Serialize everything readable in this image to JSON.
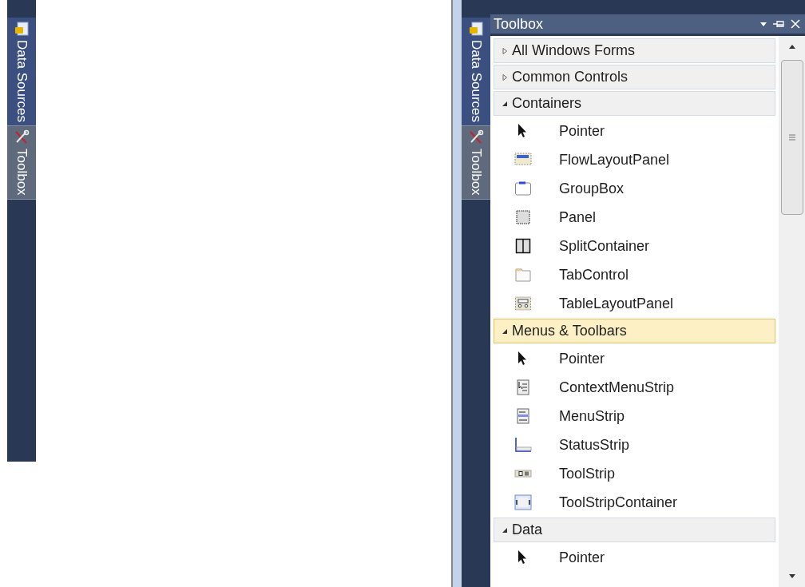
{
  "collapsed_dock": {
    "tabs": [
      {
        "label": "Data Sources",
        "kind": "data",
        "selected": false
      },
      {
        "label": "Toolbox",
        "kind": "tools",
        "selected": true
      }
    ]
  },
  "toolbox_dock": {
    "tabs": [
      {
        "label": "Data Sources",
        "kind": "data",
        "selected": false
      },
      {
        "label": "Toolbox",
        "kind": "tools",
        "selected": true
      }
    ]
  },
  "toolbox": {
    "title": "Toolbox",
    "groups": [
      {
        "label": "All Windows Forms",
        "expanded": false,
        "selected": false
      },
      {
        "label": "Common Controls",
        "expanded": false,
        "selected": false
      },
      {
        "label": "Containers",
        "expanded": true,
        "selected": false,
        "items": [
          {
            "label": "Pointer",
            "kind": "pointer"
          },
          {
            "label": "FlowLayoutPanel",
            "kind": "flow"
          },
          {
            "label": "GroupBox",
            "kind": "groupbox"
          },
          {
            "label": "Panel",
            "kind": "panel"
          },
          {
            "label": "SplitContainer",
            "kind": "split"
          },
          {
            "label": "TabControl",
            "kind": "tab"
          },
          {
            "label": "TableLayoutPanel",
            "kind": "table"
          }
        ]
      },
      {
        "label": "Menus & Toolbars",
        "expanded": true,
        "selected": true,
        "items": [
          {
            "label": "Pointer",
            "kind": "pointer"
          },
          {
            "label": "ContextMenuStrip",
            "kind": "contextmenu"
          },
          {
            "label": "MenuStrip",
            "kind": "menustrip"
          },
          {
            "label": "StatusStrip",
            "kind": "statusstrip"
          },
          {
            "label": "ToolStrip",
            "kind": "toolstrip"
          },
          {
            "label": "ToolStripContainer",
            "kind": "toolstripcontainer"
          }
        ]
      },
      {
        "label": "Data",
        "expanded": true,
        "selected": false,
        "items": [
          {
            "label": "Pointer",
            "kind": "pointer"
          }
        ]
      }
    ]
  }
}
